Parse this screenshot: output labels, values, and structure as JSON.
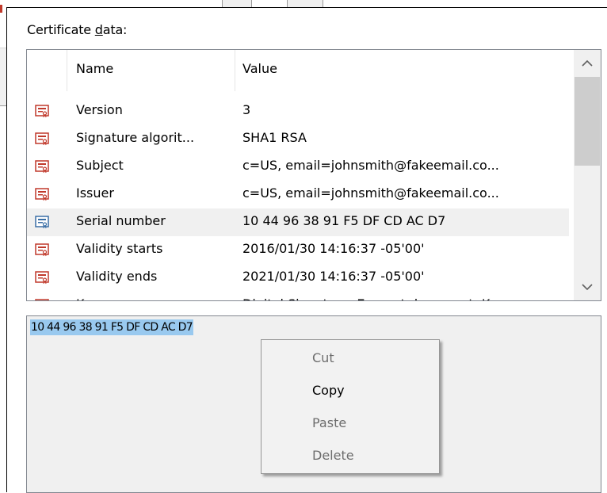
{
  "dialog": {
    "title_prefix": "Certificate ",
    "title_accel": "d",
    "title_suffix": "ata:"
  },
  "list": {
    "columns": [
      "Name",
      "Value"
    ],
    "rows": [
      {
        "name": "Version",
        "value": "3"
      },
      {
        "name": "Signature algorit...",
        "value": "SHA1 RSA"
      },
      {
        "name": "Subject",
        "value": "c=US, email=johnsmith@fakeemail.co..."
      },
      {
        "name": "Issuer",
        "value": "c=US, email=johnsmith@fakeemail.co..."
      },
      {
        "name": "Serial number",
        "value": "10 44 96 38 91 F5 DF CD AC D7",
        "selected": true
      },
      {
        "name": "Validity starts",
        "value": "2016/01/30 14:16:37 -05'00'"
      },
      {
        "name": "Validity ends",
        "value": "2021/01/30 14:16:37 -05'00'"
      },
      {
        "name": "Key usage",
        "value": "Digital Signature, Encrypt document, K"
      }
    ],
    "icon": "certificate-field-icon"
  },
  "detail": {
    "selected_text": "10 44 96 38 91 F5 DF CD AC D7"
  },
  "context_menu": {
    "items": [
      {
        "label": "Cut",
        "enabled": false
      },
      {
        "label": "Copy",
        "enabled": true
      },
      {
        "label": "Paste",
        "enabled": false
      },
      {
        "label": "Delete",
        "enabled": false
      }
    ]
  },
  "colors": {
    "selection_highlight": "#99c9ef",
    "row_selected": "#f0f0f0",
    "icon_red": "#c0392b",
    "icon_blue": "#3a6ea5"
  }
}
